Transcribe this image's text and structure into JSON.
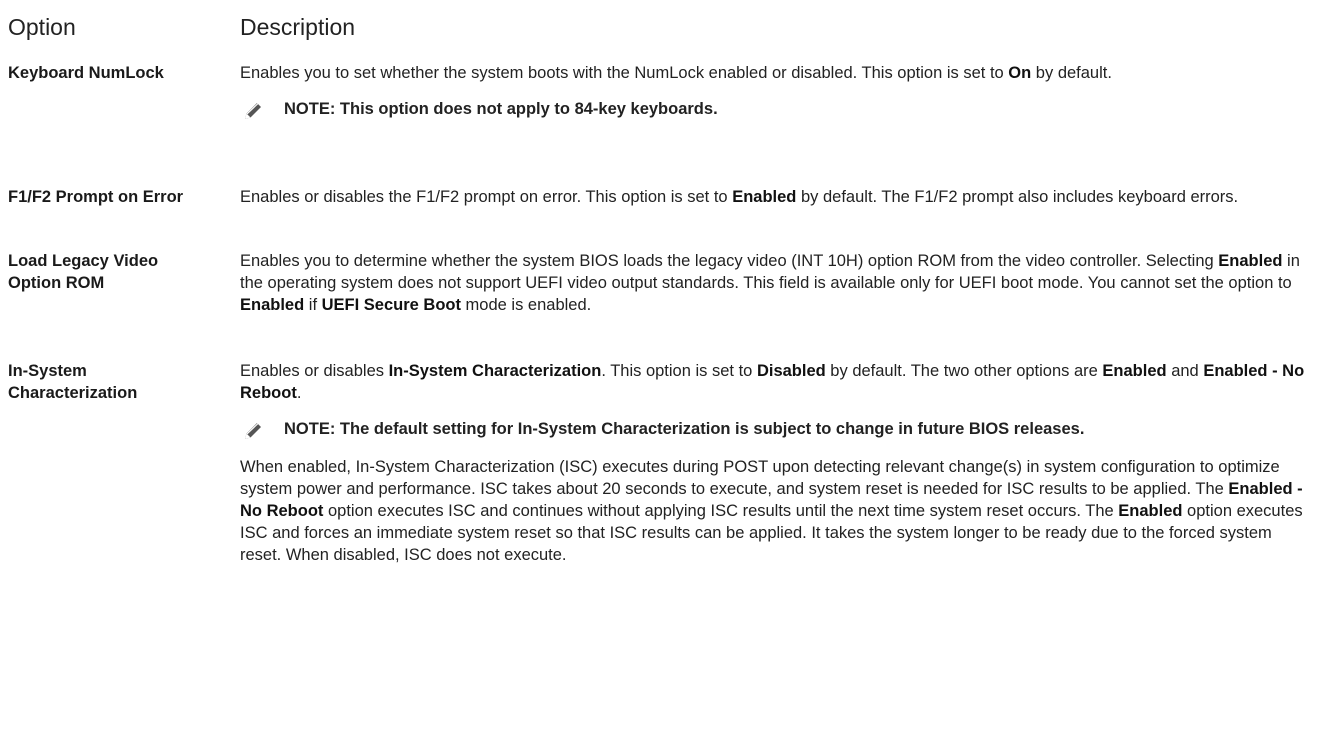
{
  "header": {
    "option": "Option",
    "description": "Description"
  },
  "rows": [
    {
      "option": "Keyboard NumLock",
      "desc": {
        "t1": "Enables you to set whether the system boots with the NumLock enabled or disabled. This option is set to ",
        "b1": "On",
        "t2": " by default."
      },
      "note": "NOTE: This option does not apply to 84-key keyboards."
    },
    {
      "option": "F1/F2 Prompt on Error",
      "desc": {
        "t1": "Enables or disables the F1/F2 prompt on error. This option is set to ",
        "b1": "Enabled",
        "t2": " by default. The F1/F2 prompt also includes keyboard errors."
      }
    },
    {
      "option": "Load Legacy Video Option ROM",
      "desc": {
        "t1": "Enables you to determine whether the system BIOS loads the legacy video (INT 10H) option ROM from the video controller. Selecting ",
        "b1": "Enabled",
        "t2": " in the operating system does not support UEFI video output standards. This field is available only for UEFI boot mode. You cannot set the option to ",
        "b2": "Enabled",
        "t3": " if ",
        "b3": "UEFI Secure Boot",
        "t4": " mode is enabled."
      }
    },
    {
      "option": "In-System Characterization",
      "desc": {
        "t1": "Enables or disables ",
        "b1": "In-System Characterization",
        "t2": ". This option is set to ",
        "b2": "Disabled",
        "t3": " by default. The two other options are ",
        "b3": "Enabled",
        "t4": " and ",
        "b4": "Enabled - No Reboot",
        "t5": "."
      },
      "note": "NOTE: The default setting for In-System Characterization is subject to change in future BIOS releases.",
      "para": {
        "t1": "When enabled, In-System Characterization (ISC) executes during POST upon detecting relevant change(s) in system configuration to optimize system power and performance. ISC takes about 20 seconds to execute, and system reset is needed for ISC results to be applied. The ",
        "b1": "Enabled - No Reboot",
        "t2": " option executes ISC and continues without applying ISC results until the next time system reset occurs. The ",
        "b2": "Enabled",
        "t3": " option executes ISC and forces an immediate system reset so that ISC results can be applied. It takes the system longer to be ready due to the forced system reset. When disabled, ISC does not execute."
      }
    }
  ]
}
